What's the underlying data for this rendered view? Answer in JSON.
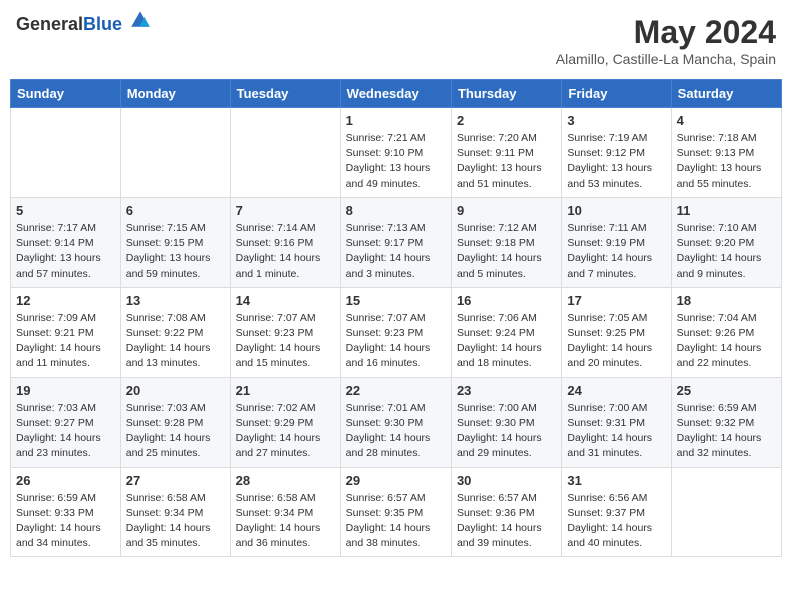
{
  "header": {
    "logo": {
      "general": "General",
      "blue": "Blue"
    },
    "title": "May 2024",
    "location": "Alamillo, Castille-La Mancha, Spain"
  },
  "weekdays": [
    "Sunday",
    "Monday",
    "Tuesday",
    "Wednesday",
    "Thursday",
    "Friday",
    "Saturday"
  ],
  "weeks": [
    [
      {
        "day": "",
        "sunrise": "",
        "sunset": "",
        "daylight": ""
      },
      {
        "day": "",
        "sunrise": "",
        "sunset": "",
        "daylight": ""
      },
      {
        "day": "",
        "sunrise": "",
        "sunset": "",
        "daylight": ""
      },
      {
        "day": "1",
        "sunrise": "Sunrise: 7:21 AM",
        "sunset": "Sunset: 9:10 PM",
        "daylight": "Daylight: 13 hours and 49 minutes."
      },
      {
        "day": "2",
        "sunrise": "Sunrise: 7:20 AM",
        "sunset": "Sunset: 9:11 PM",
        "daylight": "Daylight: 13 hours and 51 minutes."
      },
      {
        "day": "3",
        "sunrise": "Sunrise: 7:19 AM",
        "sunset": "Sunset: 9:12 PM",
        "daylight": "Daylight: 13 hours and 53 minutes."
      },
      {
        "day": "4",
        "sunrise": "Sunrise: 7:18 AM",
        "sunset": "Sunset: 9:13 PM",
        "daylight": "Daylight: 13 hours and 55 minutes."
      }
    ],
    [
      {
        "day": "5",
        "sunrise": "Sunrise: 7:17 AM",
        "sunset": "Sunset: 9:14 PM",
        "daylight": "Daylight: 13 hours and 57 minutes."
      },
      {
        "day": "6",
        "sunrise": "Sunrise: 7:15 AM",
        "sunset": "Sunset: 9:15 PM",
        "daylight": "Daylight: 13 hours and 59 minutes."
      },
      {
        "day": "7",
        "sunrise": "Sunrise: 7:14 AM",
        "sunset": "Sunset: 9:16 PM",
        "daylight": "Daylight: 14 hours and 1 minute."
      },
      {
        "day": "8",
        "sunrise": "Sunrise: 7:13 AM",
        "sunset": "Sunset: 9:17 PM",
        "daylight": "Daylight: 14 hours and 3 minutes."
      },
      {
        "day": "9",
        "sunrise": "Sunrise: 7:12 AM",
        "sunset": "Sunset: 9:18 PM",
        "daylight": "Daylight: 14 hours and 5 minutes."
      },
      {
        "day": "10",
        "sunrise": "Sunrise: 7:11 AM",
        "sunset": "Sunset: 9:19 PM",
        "daylight": "Daylight: 14 hours and 7 minutes."
      },
      {
        "day": "11",
        "sunrise": "Sunrise: 7:10 AM",
        "sunset": "Sunset: 9:20 PM",
        "daylight": "Daylight: 14 hours and 9 minutes."
      }
    ],
    [
      {
        "day": "12",
        "sunrise": "Sunrise: 7:09 AM",
        "sunset": "Sunset: 9:21 PM",
        "daylight": "Daylight: 14 hours and 11 minutes."
      },
      {
        "day": "13",
        "sunrise": "Sunrise: 7:08 AM",
        "sunset": "Sunset: 9:22 PM",
        "daylight": "Daylight: 14 hours and 13 minutes."
      },
      {
        "day": "14",
        "sunrise": "Sunrise: 7:07 AM",
        "sunset": "Sunset: 9:23 PM",
        "daylight": "Daylight: 14 hours and 15 minutes."
      },
      {
        "day": "15",
        "sunrise": "Sunrise: 7:07 AM",
        "sunset": "Sunset: 9:23 PM",
        "daylight": "Daylight: 14 hours and 16 minutes."
      },
      {
        "day": "16",
        "sunrise": "Sunrise: 7:06 AM",
        "sunset": "Sunset: 9:24 PM",
        "daylight": "Daylight: 14 hours and 18 minutes."
      },
      {
        "day": "17",
        "sunrise": "Sunrise: 7:05 AM",
        "sunset": "Sunset: 9:25 PM",
        "daylight": "Daylight: 14 hours and 20 minutes."
      },
      {
        "day": "18",
        "sunrise": "Sunrise: 7:04 AM",
        "sunset": "Sunset: 9:26 PM",
        "daylight": "Daylight: 14 hours and 22 minutes."
      }
    ],
    [
      {
        "day": "19",
        "sunrise": "Sunrise: 7:03 AM",
        "sunset": "Sunset: 9:27 PM",
        "daylight": "Daylight: 14 hours and 23 minutes."
      },
      {
        "day": "20",
        "sunrise": "Sunrise: 7:03 AM",
        "sunset": "Sunset: 9:28 PM",
        "daylight": "Daylight: 14 hours and 25 minutes."
      },
      {
        "day": "21",
        "sunrise": "Sunrise: 7:02 AM",
        "sunset": "Sunset: 9:29 PM",
        "daylight": "Daylight: 14 hours and 27 minutes."
      },
      {
        "day": "22",
        "sunrise": "Sunrise: 7:01 AM",
        "sunset": "Sunset: 9:30 PM",
        "daylight": "Daylight: 14 hours and 28 minutes."
      },
      {
        "day": "23",
        "sunrise": "Sunrise: 7:00 AM",
        "sunset": "Sunset: 9:30 PM",
        "daylight": "Daylight: 14 hours and 29 minutes."
      },
      {
        "day": "24",
        "sunrise": "Sunrise: 7:00 AM",
        "sunset": "Sunset: 9:31 PM",
        "daylight": "Daylight: 14 hours and 31 minutes."
      },
      {
        "day": "25",
        "sunrise": "Sunrise: 6:59 AM",
        "sunset": "Sunset: 9:32 PM",
        "daylight": "Daylight: 14 hours and 32 minutes."
      }
    ],
    [
      {
        "day": "26",
        "sunrise": "Sunrise: 6:59 AM",
        "sunset": "Sunset: 9:33 PM",
        "daylight": "Daylight: 14 hours and 34 minutes."
      },
      {
        "day": "27",
        "sunrise": "Sunrise: 6:58 AM",
        "sunset": "Sunset: 9:34 PM",
        "daylight": "Daylight: 14 hours and 35 minutes."
      },
      {
        "day": "28",
        "sunrise": "Sunrise: 6:58 AM",
        "sunset": "Sunset: 9:34 PM",
        "daylight": "Daylight: 14 hours and 36 minutes."
      },
      {
        "day": "29",
        "sunrise": "Sunrise: 6:57 AM",
        "sunset": "Sunset: 9:35 PM",
        "daylight": "Daylight: 14 hours and 38 minutes."
      },
      {
        "day": "30",
        "sunrise": "Sunrise: 6:57 AM",
        "sunset": "Sunset: 9:36 PM",
        "daylight": "Daylight: 14 hours and 39 minutes."
      },
      {
        "day": "31",
        "sunrise": "Sunrise: 6:56 AM",
        "sunset": "Sunset: 9:37 PM",
        "daylight": "Daylight: 14 hours and 40 minutes."
      },
      {
        "day": "",
        "sunrise": "",
        "sunset": "",
        "daylight": ""
      }
    ]
  ]
}
